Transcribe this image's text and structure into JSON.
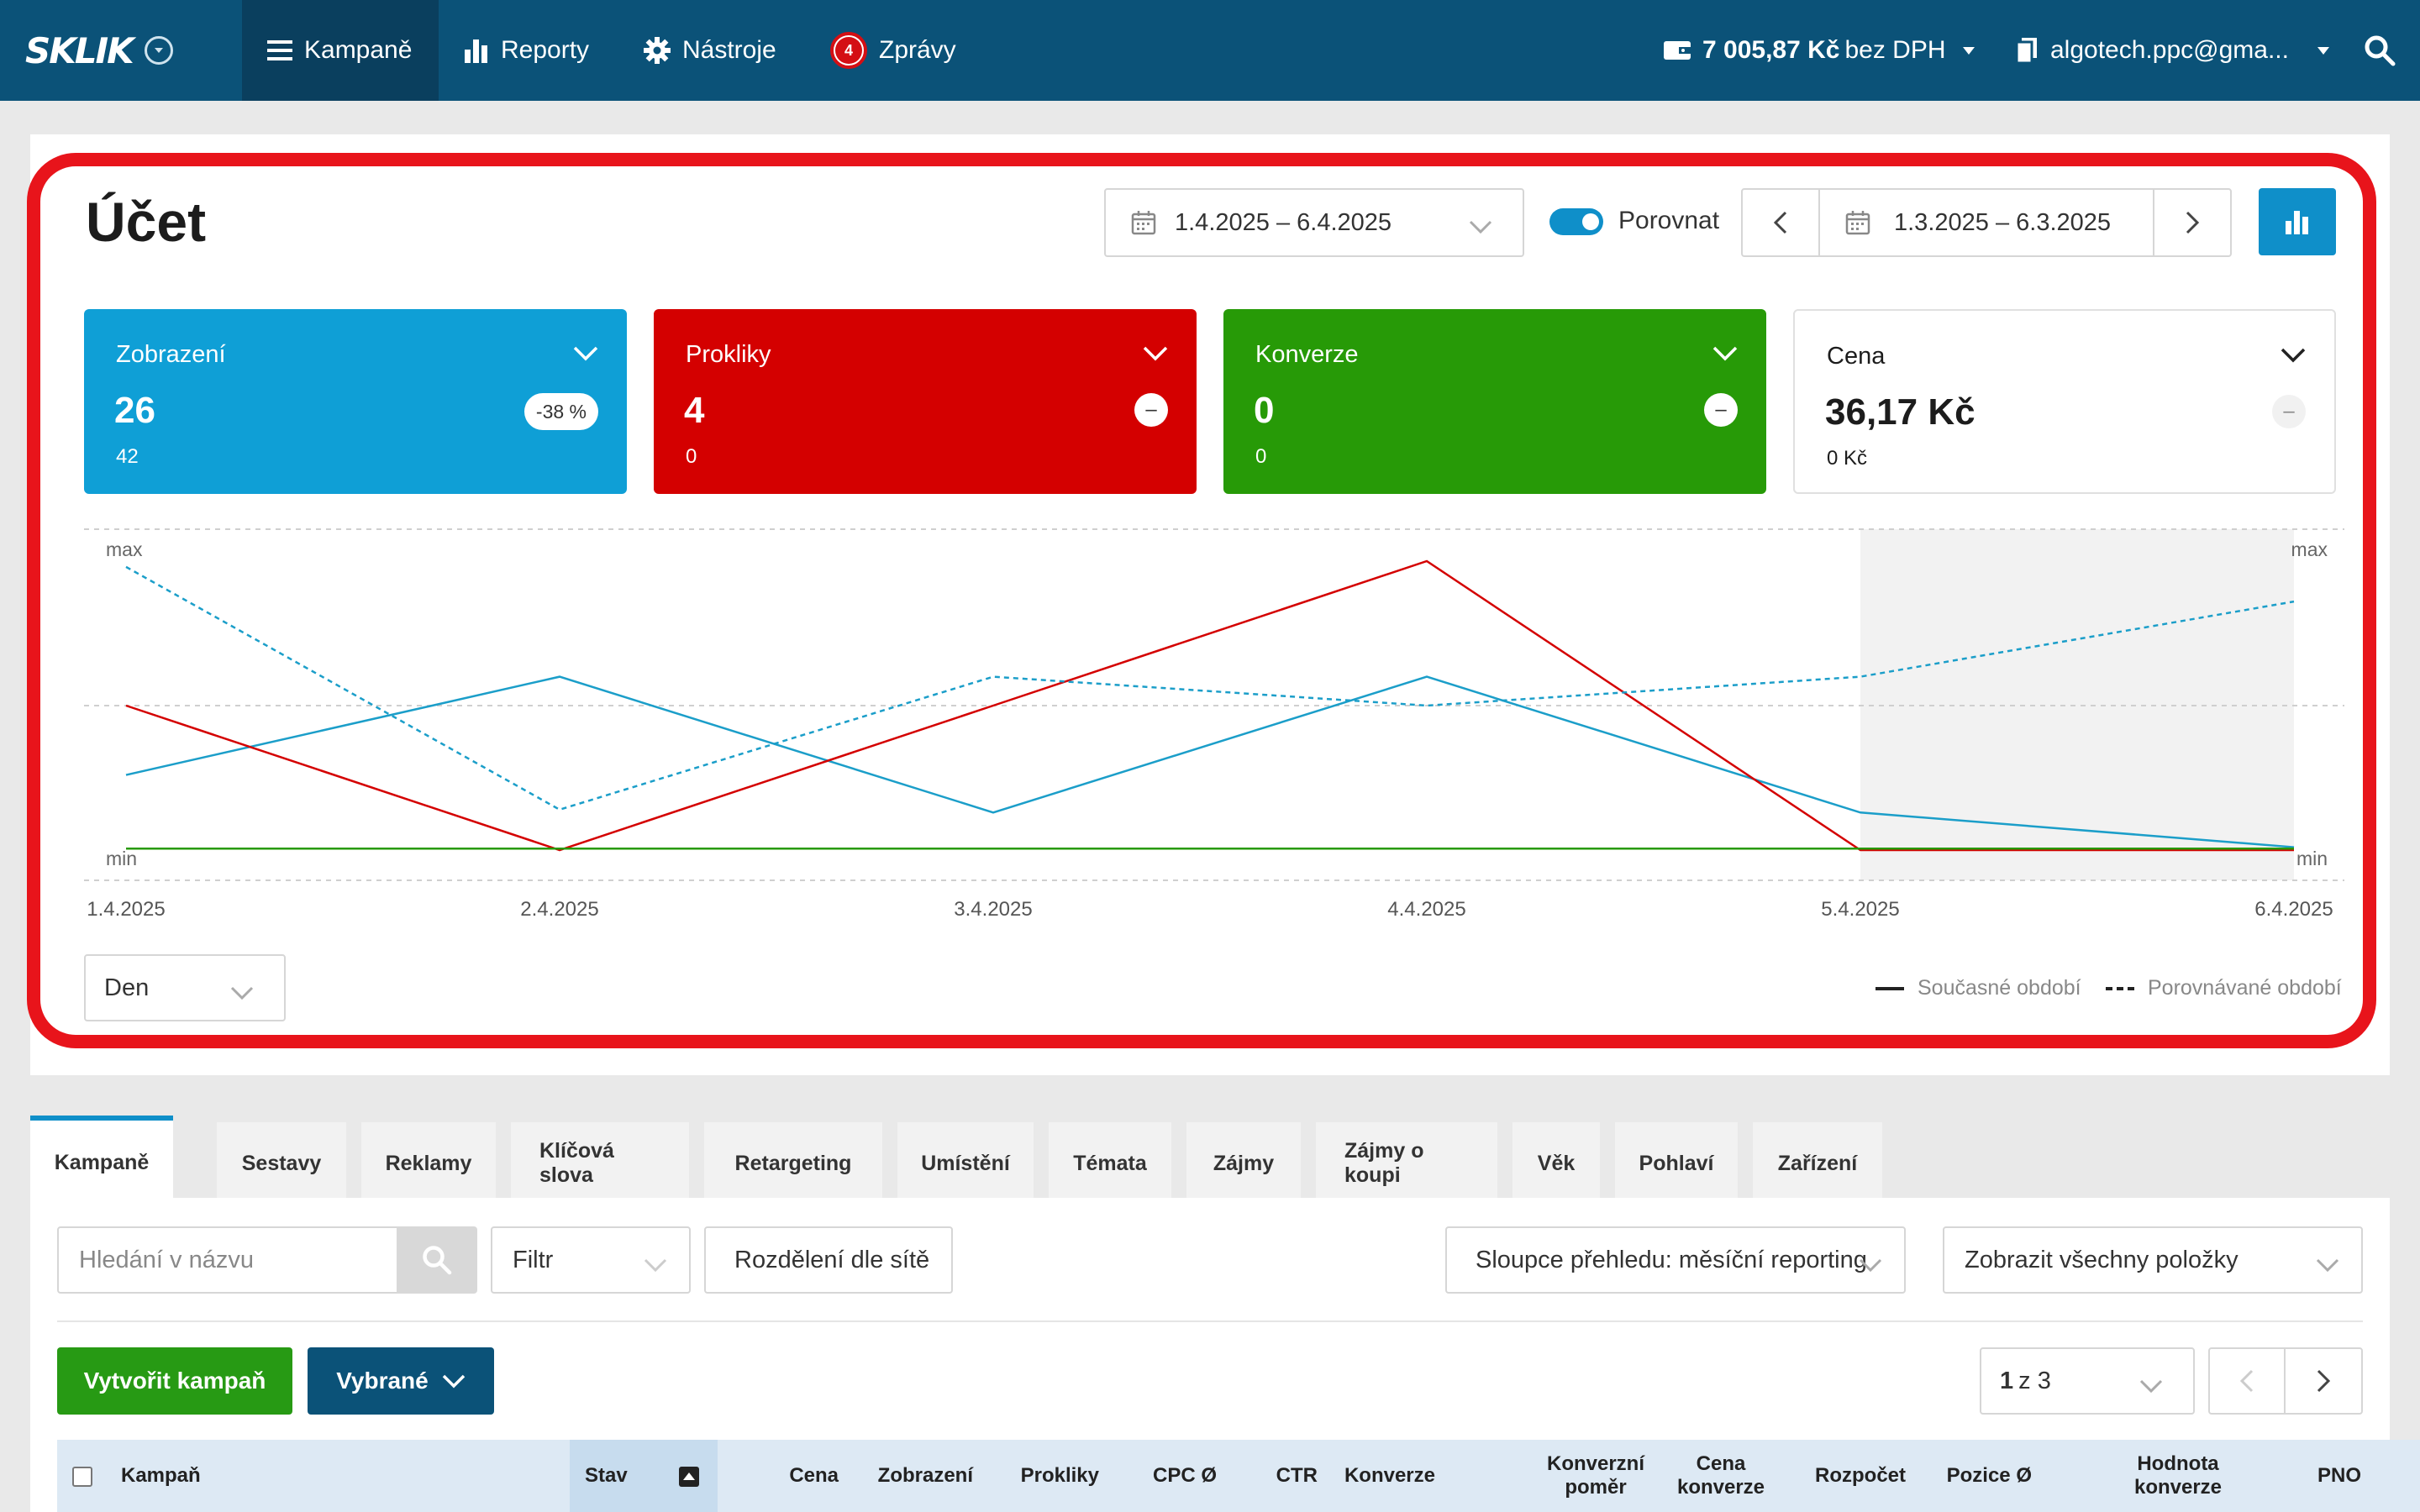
{
  "nav": {
    "logo": "SKLIK",
    "items": [
      {
        "label": "Kampaně",
        "icon": "hamburger-icon",
        "active": true
      },
      {
        "label": "Reporty",
        "icon": "bar-chart-icon"
      },
      {
        "label": "Nástroje",
        "icon": "gear-icon"
      },
      {
        "label": "Zprávy",
        "icon": "badge-icon",
        "badge": "4"
      }
    ],
    "credit_amount": "7 005,87 Kč",
    "credit_suffix": "bez DPH",
    "account": "algotech.ppc@gma..."
  },
  "page": {
    "title": "Účet",
    "date_range": "1.4.2025 – 6.4.2025",
    "compare_label": "Porovnat",
    "compare_range": "1.3.2025 – 6.3.2025"
  },
  "metrics": [
    {
      "label": "Zobrazení",
      "value": "26",
      "compare": "42",
      "change": "-38 %",
      "color": "#0f9fd6"
    },
    {
      "label": "Prokliky",
      "value": "4",
      "compare": "0",
      "change": "–",
      "color": "#d40000"
    },
    {
      "label": "Konverze",
      "value": "0",
      "compare": "0",
      "change": "–",
      "color": "#279a07"
    },
    {
      "label": "Cena",
      "value": "36,17 Kč",
      "compare": "0 Kč",
      "change": "–",
      "color": "#ffffff"
    }
  ],
  "chart_data": {
    "type": "line",
    "categories": [
      "1.4.2025",
      "2.4.2025",
      "3.4.2025",
      "4.4.2025",
      "5.4.2025",
      "6.4.2025"
    ],
    "y_min_label": "min",
    "y_max_label": "max",
    "ylim": [
      0,
      1
    ],
    "shaded_from": "5.4.2025",
    "series": [
      {
        "metric": "Zobrazení",
        "period": "current",
        "color": "#1b9ec9",
        "dashed": false,
        "values": [
          0.26,
          0.6,
          0.13,
          0.6,
          0.13,
          0.01
        ]
      },
      {
        "metric": "Prokliky",
        "period": "current",
        "color": "#d40000",
        "dashed": false,
        "values": [
          0.5,
          0.0,
          0.5,
          1.0,
          0.0,
          0.0
        ]
      },
      {
        "metric": "Konverze",
        "period": "current",
        "color": "#279a07",
        "dashed": false,
        "values": [
          0.005,
          0.005,
          0.005,
          0.005,
          0.005,
          0.005
        ]
      },
      {
        "metric": "Zobrazení",
        "period": "compared",
        "color": "#1b9ec9",
        "dashed": true,
        "values": [
          0.98,
          0.14,
          0.6,
          0.5,
          0.6,
          0.86
        ]
      }
    ],
    "legend": [
      {
        "label": "Současné období",
        "dashed": false
      },
      {
        "label": "Porovnávané období",
        "dashed": true
      }
    ]
  },
  "period_select": "Den",
  "tabs": [
    "Kampaně",
    "Sestavy",
    "Reklamy",
    "Klíčová slova",
    "Retargeting",
    "Umístění",
    "Témata",
    "Zájmy",
    "Zájmy o koupi",
    "Věk",
    "Pohlaví",
    "Zařízení"
  ],
  "toolbar": {
    "search_placeholder": "Hledání v názvu",
    "filter": "Filtr",
    "split_by_network": "Rozdělení dle sítě",
    "columns_select": "Sloupce přehledu: měsíční reporting",
    "show_select": "Zobrazit všechny položky",
    "create_campaign": "Vytvořit kampaň",
    "selected": "Vybrané",
    "page_current": "1",
    "page_of": "z 3"
  },
  "table_headers": [
    "Kampaň",
    "Stav",
    "Cena",
    "Zobrazení",
    "Prokliky",
    "CPC Ø",
    "CTR",
    "Konverze",
    "Konverzní poměr",
    "Cena konverze",
    "Rozpočet",
    "Pozice Ø",
    "Hodnota konverze",
    "PNO"
  ]
}
